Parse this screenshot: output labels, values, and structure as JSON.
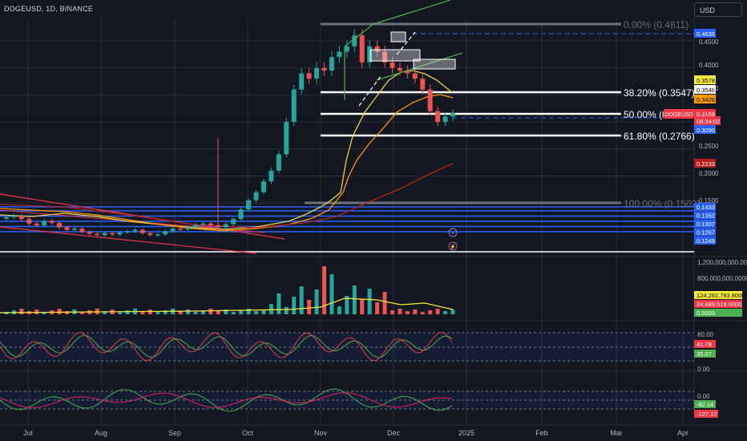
{
  "header": {
    "symbol_line": "DOGEUSD, 1D, BINANCE",
    "currency": "USD"
  },
  "colors": {
    "bg": "#131722",
    "grid": "#2a2e39",
    "up": "#26a69a",
    "down": "#ef5350",
    "green_channel": "#4caf50",
    "red_channel": "#f23645",
    "yellow_ma": "#e8d44d",
    "orange_ma": "#ff9800",
    "dark_red_ma": "#b22222",
    "blue_zone": "#2962ff",
    "white": "#ffffff",
    "gray_level": "#787b86",
    "rsi": "#f44336",
    "rsi_signal": "#4caf50"
  },
  "chart_data": {
    "type": "line",
    "symbol": "DOGEUSD",
    "timeframe": "1D",
    "exchange": "BINANCE",
    "x_labels": [
      "Jul",
      "Aug",
      "Sep",
      "Oct",
      "Nov",
      "Dec",
      "2025",
      "Feb",
      "Mar",
      "Apr"
    ],
    "price_axis_ticks": [
      "0.4500",
      "0.4000",
      "0.3500",
      "0.3000",
      "0.2500",
      "0.2000",
      "0.1500"
    ],
    "fib_levels": [
      {
        "label": "0.00% (0.4811)",
        "value": 0.4811
      },
      {
        "label": "38.20% (0.3547)",
        "value": 0.3547
      },
      {
        "label": "50.00% (0.",
        "value": 0.3159
      },
      {
        "label": "61.80% (0.2766)",
        "value": 0.2766
      },
      {
        "label": "100.00% (0.1502)",
        "value": 0.1502
      }
    ],
    "price_tags": [
      {
        "text": "0.4635",
        "kind": "blue"
      },
      {
        "text": "0.3578",
        "kind": "yellow"
      },
      {
        "text": "0.3546",
        "kind": "white"
      },
      {
        "text": "0.3426",
        "kind": "orange"
      },
      {
        "text": "0.3159",
        "kind": "red"
      },
      {
        "text": "DOGEUSD",
        "kind": "red"
      },
      {
        "text": "08:34:02",
        "kind": "red"
      },
      {
        "text": "0.3090",
        "kind": "blue"
      },
      {
        "text": "0.2233",
        "kind": "darkred"
      }
    ],
    "zone_tags": [
      "0.1433",
      "0.1352",
      "0.1307",
      "0.1267",
      "0.1249"
    ],
    "volume_ticks": [
      "1,200,000,000.0000",
      "800,000,000.0000"
    ],
    "volume_tags": [
      "124,292,783.8000",
      "24,689,519.0000",
      "0.0000"
    ],
    "rsi_ticks": [
      "80.00",
      "0.00"
    ],
    "rsi_tags": [
      "41.79",
      "35.07"
    ],
    "osc_ticks": [
      "0.00"
    ],
    "osc_tags": [
      "-82.14",
      "-127.17"
    ],
    "close_series": [
      0.128,
      0.13,
      0.125,
      0.118,
      0.115,
      0.122,
      0.119,
      0.112,
      0.108,
      0.11,
      0.105,
      0.102,
      0.1,
      0.103,
      0.101,
      0.104,
      0.106,
      0.108,
      0.103,
      0.1,
      0.101,
      0.106,
      0.11,
      0.109,
      0.112,
      0.116,
      0.118,
      0.115,
      0.112,
      0.117,
      0.125,
      0.14,
      0.155,
      0.17,
      0.19,
      0.21,
      0.24,
      0.3,
      0.36,
      0.39,
      0.38,
      0.4,
      0.395,
      0.42,
      0.43,
      0.44,
      0.46,
      0.41,
      0.44,
      0.43,
      0.41,
      0.4,
      0.395,
      0.39,
      0.38,
      0.36,
      0.32,
      0.3,
      0.31,
      0.316
    ]
  }
}
